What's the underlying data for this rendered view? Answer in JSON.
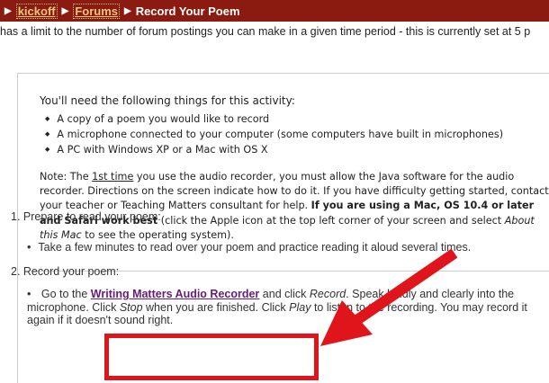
{
  "breadcrumb": {
    "items": [
      {
        "label": "kickoff",
        "link": true
      },
      {
        "label": "Forums",
        "link": true
      },
      {
        "label": "Record Your Poem",
        "link": false
      }
    ]
  },
  "notice": "has a limit to the number of forum postings you can make in a given time period - this is currently set at 5 p",
  "requirements": {
    "title": "You'll need the following things for this activity:",
    "items": [
      "A copy of a poem you would like to record",
      "A microphone connected to your computer (some computers have built in microphones)",
      "A PC with Windows XP or a Mac with OS X"
    ]
  },
  "note": {
    "prefix": "Note: The ",
    "first_time": "1st time",
    "text1": " you use the audio recorder, you must allow the Java software for the audio recorder. Directions on the screen indicate how to do it. If you have difficulty getting started, contact your teacher or Teaching Matters consultant for help. ",
    "bold": "If you are using a Mac, OS 10.4 or later and Safari work best",
    "text2": " (click the Apple icon at the top left corner of your screen and select ",
    "italic": "About this Mac",
    "text3": " to see the operating system)."
  },
  "steps": {
    "step1": "1. Prepare to read your poem:",
    "bullet1": "Take a few minutes to read over your poem and practice reading it aloud several times.",
    "step2": "2. Record your poem:",
    "bullet2_prefix": "Go to the ",
    "bullet2_link": "Writing Matters Audio Recorder",
    "bullet2_mid1": " and click ",
    "bullet2_record": "Record",
    "bullet2_mid2": ". Speak loudly and clearly into the microphone. Click ",
    "bullet2_stop": "Stop",
    "bullet2_mid3": " when you are finished. Click ",
    "bullet2_play": "Play",
    "bullet2_end": " to listen to the recording. You may record it again if it doesn't sound right."
  },
  "colors": {
    "header_bg": "#8b1a10",
    "link_color": "#6a1a7a",
    "annotation_red": "#e0141b"
  }
}
